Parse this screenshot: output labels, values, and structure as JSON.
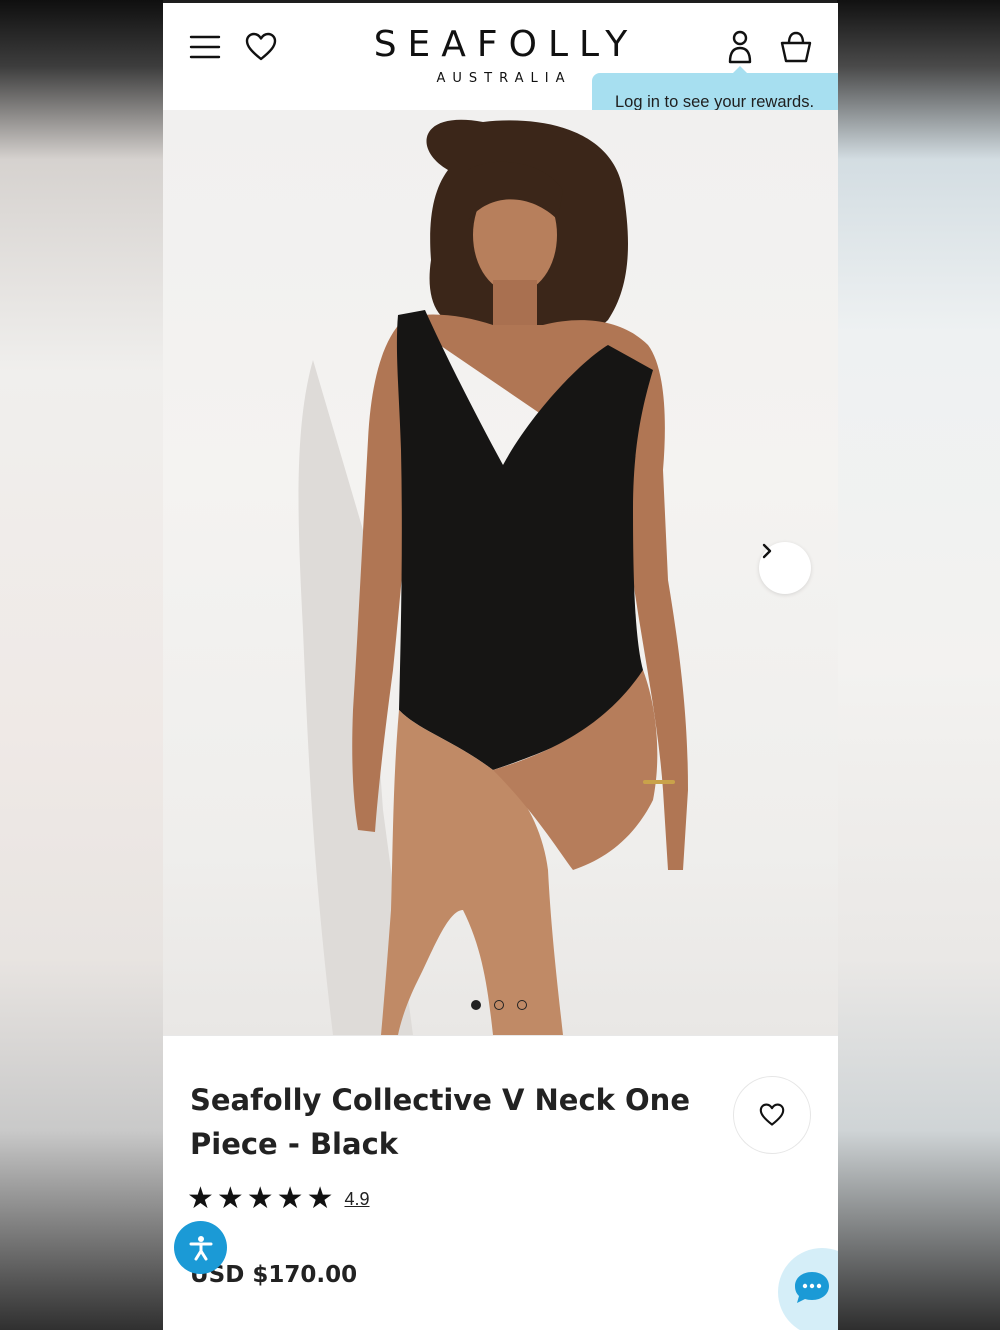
{
  "brand": {
    "name": "SEAFOLLY",
    "subname": "AUSTRALIA"
  },
  "header": {
    "menu_icon": "hamburger-menu-icon",
    "wishlist_icon": "heart-icon",
    "account_icon": "user-icon",
    "bag_icon": "shopping-bag-icon",
    "tooltip": "Log in to see your rewards."
  },
  "gallery": {
    "image_count": 3,
    "active_index": 0,
    "next_icon": "chevron-right-icon"
  },
  "product": {
    "title": "Seafolly Collective V Neck One Piece - Black",
    "rating_stars": "★★★★★",
    "rating_value": "4.9",
    "price": "USD $170.00",
    "wishlist_icon": "heart-icon"
  },
  "widgets": {
    "accessibility_icon": "accessibility-icon",
    "chat_icon": "chat-bubble-icon"
  },
  "colors": {
    "tooltip_bg": "#a7dff0",
    "accessibility_bg": "#1b9ad6",
    "chat_bg": "#d5eef8"
  }
}
